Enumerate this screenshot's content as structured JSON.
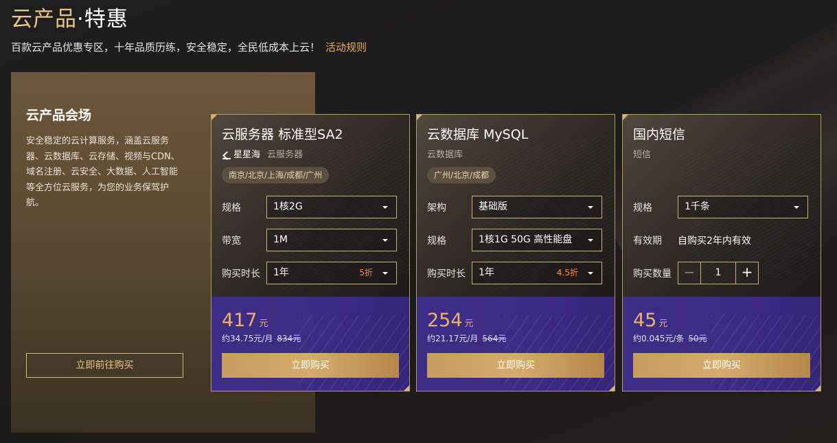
{
  "header": {
    "title_part1": "云产品",
    "title_sep": "·",
    "title_part2": "特惠",
    "subtitle": "百款云产品优惠专区，十年品质历练，安全稳定，全民低成本上云！",
    "rules_link": "活动规则"
  },
  "venue": {
    "title": "云产品会场",
    "description": "安全稳定的云计算服务，涵盖云服务器、云数据库、云存储、视频与CDN、域名注册、云安全、大数据、人工智能等全方位云服务，为您的业务保驾护航。",
    "button": "立即前往购买"
  },
  "cards": [
    {
      "name": "云服务器 标准型SA2",
      "brand": "星星海",
      "category": "云服务器",
      "region": "南京/北京/上海/成都/广州",
      "rows": [
        {
          "label": "规格",
          "value": "1核2G"
        },
        {
          "label": "带宽",
          "value": "1M"
        },
        {
          "label": "购买时长",
          "value": "1年",
          "discount": "5折"
        }
      ],
      "price": "417",
      "price_unit": "元",
      "per_unit": "约34.75元/月",
      "original_price": "834元",
      "buy": "立即购买"
    },
    {
      "name": "云数据库 MySQL",
      "category": "云数据库",
      "region": "广州/北京/成都",
      "rows": [
        {
          "label": "架构",
          "value": "基础版"
        },
        {
          "label": "规格",
          "value": "1核1G 50G 高性能盘"
        },
        {
          "label": "购买时长",
          "value": "1年",
          "discount": "4.5折"
        }
      ],
      "price": "254",
      "price_unit": "元",
      "per_unit": "约21.17元/月",
      "original_price": "564元",
      "buy": "立即购买"
    },
    {
      "name": "国内短信",
      "category": "短信",
      "rows": [
        {
          "label": "规格",
          "value": "1千条"
        },
        {
          "label": "有效期",
          "value": "自购买2年内有效"
        },
        {
          "label": "购买数量",
          "value": "1",
          "minus": "−",
          "plus": "+"
        }
      ],
      "price": "45",
      "price_unit": "元",
      "per_unit": "约0.045元/条",
      "original_price": "50元",
      "buy": "立即购买"
    }
  ],
  "colors": {
    "gold": "#e9c58d",
    "accent_link": "#e6ad5e",
    "price": "#f2b06b",
    "discount": "#ff8a3c",
    "purple": "#3c2d86"
  }
}
